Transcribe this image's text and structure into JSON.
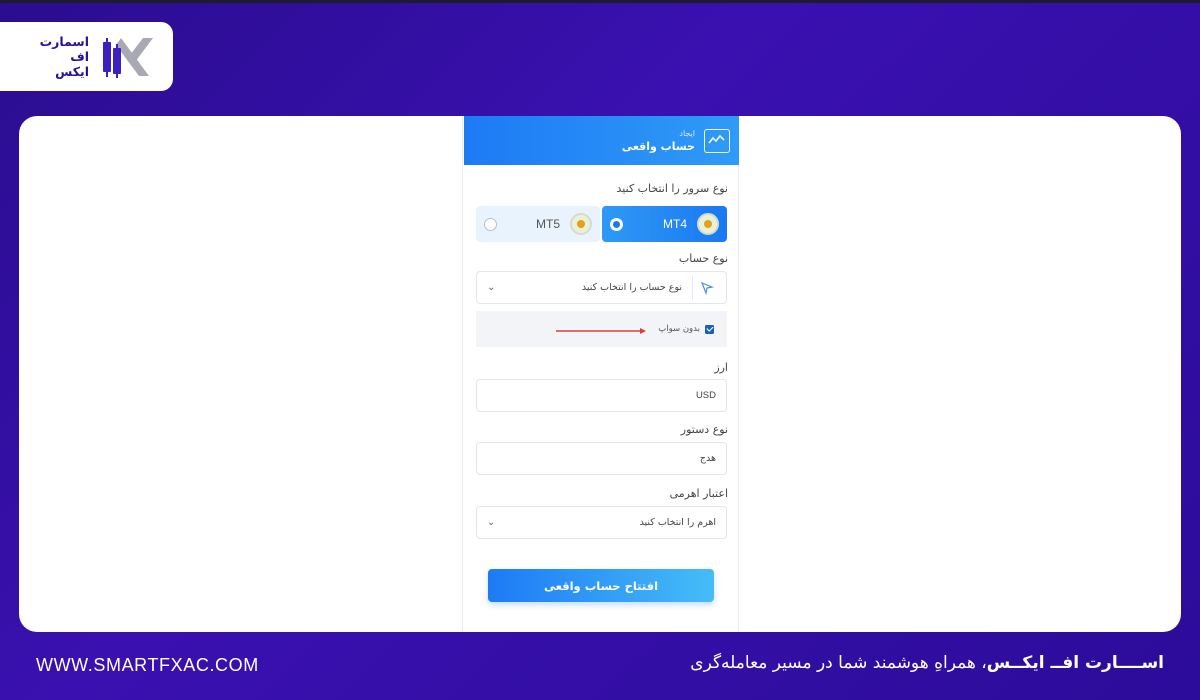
{
  "brand": {
    "logo_line1": "اسمارت",
    "logo_line2": "اف",
    "logo_line3": "ایکس"
  },
  "panel": {
    "header_small": "ایجاد",
    "header_title": "حساب واقعی",
    "server_label": "نوع سرور را انتخاب کنید",
    "servers": [
      {
        "name": "MT4",
        "selected": true
      },
      {
        "name": "MT5",
        "selected": false
      }
    ],
    "account_type_label": "نوع حساب",
    "account_type_placeholder": "نوع حساب را انتخاب کنید",
    "swap_label": "بدون سواپ",
    "swap_checked": true,
    "currency_label": "ارز",
    "currency_value": "USD",
    "order_type_label": "نوع دستور",
    "order_type_value": "هدج",
    "leverage_label": "اعتبار اهرمی",
    "leverage_placeholder": "اهرم را انتخاب کنید",
    "submit_label": "افتتاح حساب واقعی"
  },
  "footer": {
    "url": "WWW.SMARTFXAC.COM",
    "brand_name": "اســــارت افــ ایکــس",
    "tagline": "، همراهِ هوشمند شما در مسیر معامله‌گری"
  },
  "colors": {
    "background": "#2a0d8f",
    "accent": "#1d7af5",
    "brand": "#2b0fa0"
  }
}
